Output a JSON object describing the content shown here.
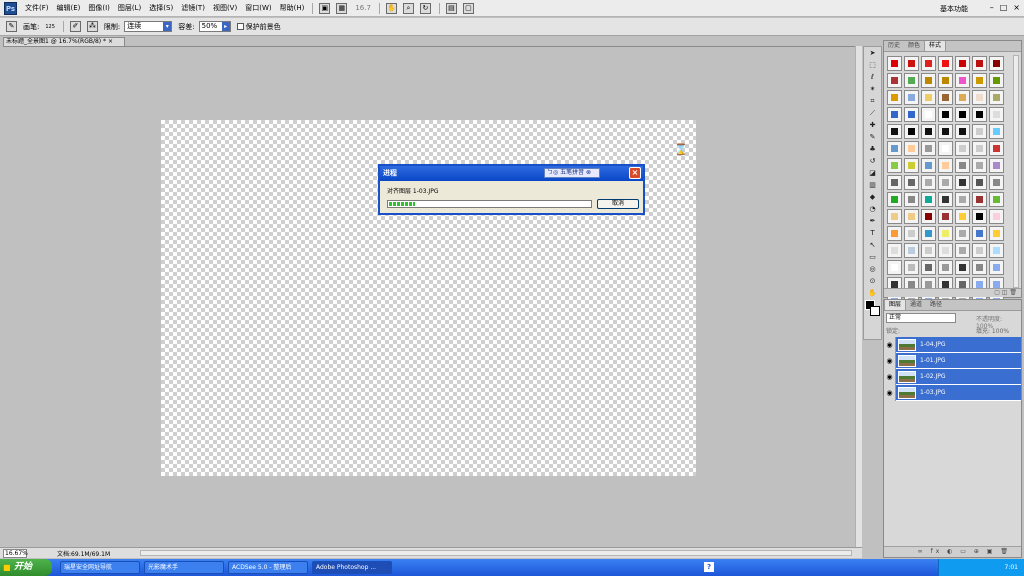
{
  "app": {
    "logo": "Ps",
    "menus": [
      "文件(F)",
      "编辑(E)",
      "图像(I)",
      "图层(L)",
      "选择(S)",
      "滤镜(T)",
      "视图(V)",
      "窗口(W)",
      "帮助(H)"
    ],
    "zoom_combo": "16.7",
    "workspace": "基本功能",
    "window_controls": [
      "–",
      "□",
      "×"
    ]
  },
  "options_bar": {
    "brush_label": "画笔:",
    "brush_size": "125",
    "mode_label": "模式:",
    "mode_value": "正常",
    "tolerance_label": "容差:",
    "tolerance_value": "50%",
    "protect_label": "保护前景色",
    "sampling_label": "限制:",
    "sampling_value": "连续"
  },
  "document": {
    "tab_title": "未标题_全景图1 @ 16.7%(RGB/8) * ×",
    "status_zoom": "16.67%",
    "status_doc": "文档:69.1M/69.1M"
  },
  "dialog": {
    "title": "进程",
    "ime": "ㄅ◎ 五笔拼音 ⊗",
    "message": "对齐图层 1-03.JPG",
    "progress": 0.13,
    "cancel": "取消",
    "close": "×"
  },
  "styles_panel": {
    "tabs": [
      "历史",
      "颜色",
      "样式"
    ],
    "swatches": [
      "#d00",
      "#c11",
      "#d22",
      "#e11",
      "#c00",
      "#b11",
      "#800",
      "#a33",
      "#5a5",
      "#b80",
      "#b80",
      "#e5c",
      "#c90",
      "#690",
      "#d90",
      "#8ad",
      "#ec6",
      "#963",
      "#da5",
      "#edc",
      "#aa6",
      "#36c",
      "#36c",
      "#fff",
      "#000",
      "#000",
      "#000",
      "#ddd",
      "#111",
      "#000",
      "#111",
      "#111",
      "#111",
      "#ccc",
      "#6cf",
      "#69c",
      "#fc9",
      "#999",
      "#fff",
      "#ccc",
      "#ccc",
      "#c33",
      "#8c4",
      "#cc3",
      "#69c",
      "#fc9",
      "#888",
      "#aaa",
      "#a8c",
      "#666",
      "#666",
      "#aaa",
      "#aaa",
      "#333",
      "#555",
      "#888",
      "#2a2",
      "#888",
      "#1a9",
      "#333",
      "#aaa",
      "#933",
      "#6b3",
      "#ec8",
      "#ec8",
      "#800",
      "#933",
      "#fc3",
      "#000",
      "#fcd",
      "#f93",
      "#ccc",
      "#39c",
      "#ee6",
      "#aaa",
      "#47c",
      "#fc3",
      "#ddd",
      "#bcd",
      "#ccc",
      "#ddd",
      "#aaa",
      "#ccc",
      "#adf",
      "#fff",
      "#bbb",
      "#666",
      "#999",
      "#333",
      "#888",
      "#8ae",
      "#333",
      "#888",
      "#999",
      "#333",
      "#666",
      "#8ae",
      "#8ae",
      "#8ae",
      "#aaa",
      "#8ae",
      "#aaa",
      "#aaa",
      "#8ae",
      "#8ae"
    ]
  },
  "layers_panel": {
    "tabs": [
      "图层",
      "通道",
      "路径"
    ],
    "blend_mode": "正常",
    "opacity": "不透明度: 100%",
    "lock": "锁定:",
    "fill": "填充: 100%",
    "layers": [
      "1-04.JPG",
      "1-01.JPG",
      "1-02.JPG",
      "1-03.JPG"
    ],
    "footer_icons": "∞ fx ◐ ▭ ⊕ ▣ 🗑"
  },
  "taskbar": {
    "start": "开始",
    "tasks": [
      "瑞星安全网址导航",
      "光影魔术手",
      "ACDSee 5.0 - 整理后",
      "Adobe Photoshop ..."
    ],
    "tray_time": "7:01"
  }
}
